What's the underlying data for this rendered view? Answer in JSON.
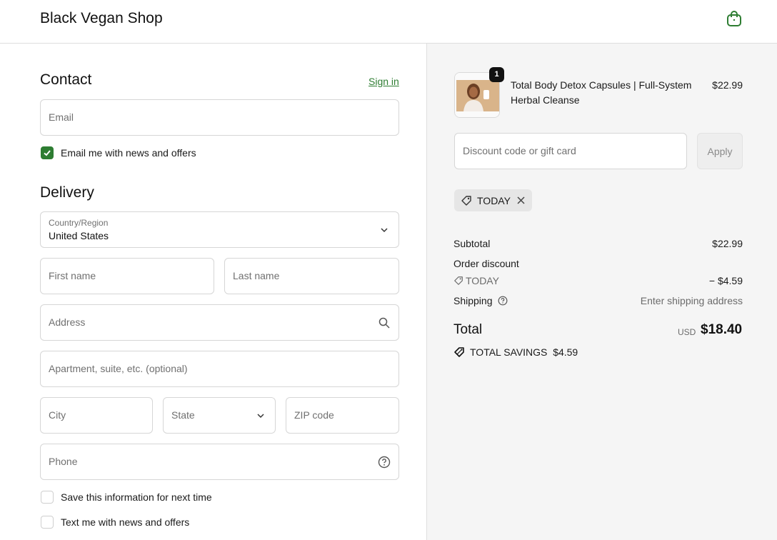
{
  "header": {
    "shop_name": "Black Vegan Shop",
    "cart_icon": "shopping-bag-icon"
  },
  "contact": {
    "title": "Contact",
    "sign_in": "Sign in",
    "email_placeholder": "Email",
    "email_news_label": "Email me with news and offers",
    "email_news_checked": true
  },
  "delivery": {
    "title": "Delivery",
    "country_label": "Country/Region",
    "country_value": "United States",
    "first_name_placeholder": "First name",
    "last_name_placeholder": "Last name",
    "address_placeholder": "Address",
    "apartment_placeholder": "Apartment, suite, etc. (optional)",
    "city_placeholder": "City",
    "state_placeholder": "State",
    "zip_placeholder": "ZIP code",
    "phone_placeholder": "Phone",
    "save_info_label": "Save this information for next time",
    "text_news_label": "Text me with news and offers"
  },
  "summary": {
    "product": {
      "title": "Total Body Detox Capsules | Full-System Herbal Cleanse",
      "price": "$22.99",
      "quantity": "1"
    },
    "discount_placeholder": "Discount code or gift card",
    "apply_label": "Apply",
    "applied_code": "TODAY",
    "subtotal_label": "Subtotal",
    "subtotal_value": "$22.99",
    "order_discount_label": "Order discount",
    "discount_code": "TODAY",
    "discount_value": "− $4.59",
    "shipping_label": "Shipping",
    "shipping_value": "Enter shipping address",
    "total_label": "Total",
    "currency": "USD",
    "total_value": "$18.40",
    "savings_label": "TOTAL SAVINGS",
    "savings_value": "$4.59"
  },
  "colors": {
    "accent": "#2e7d32",
    "summary_bg": "#f5f5f5",
    "border": "#d6d6d6"
  }
}
